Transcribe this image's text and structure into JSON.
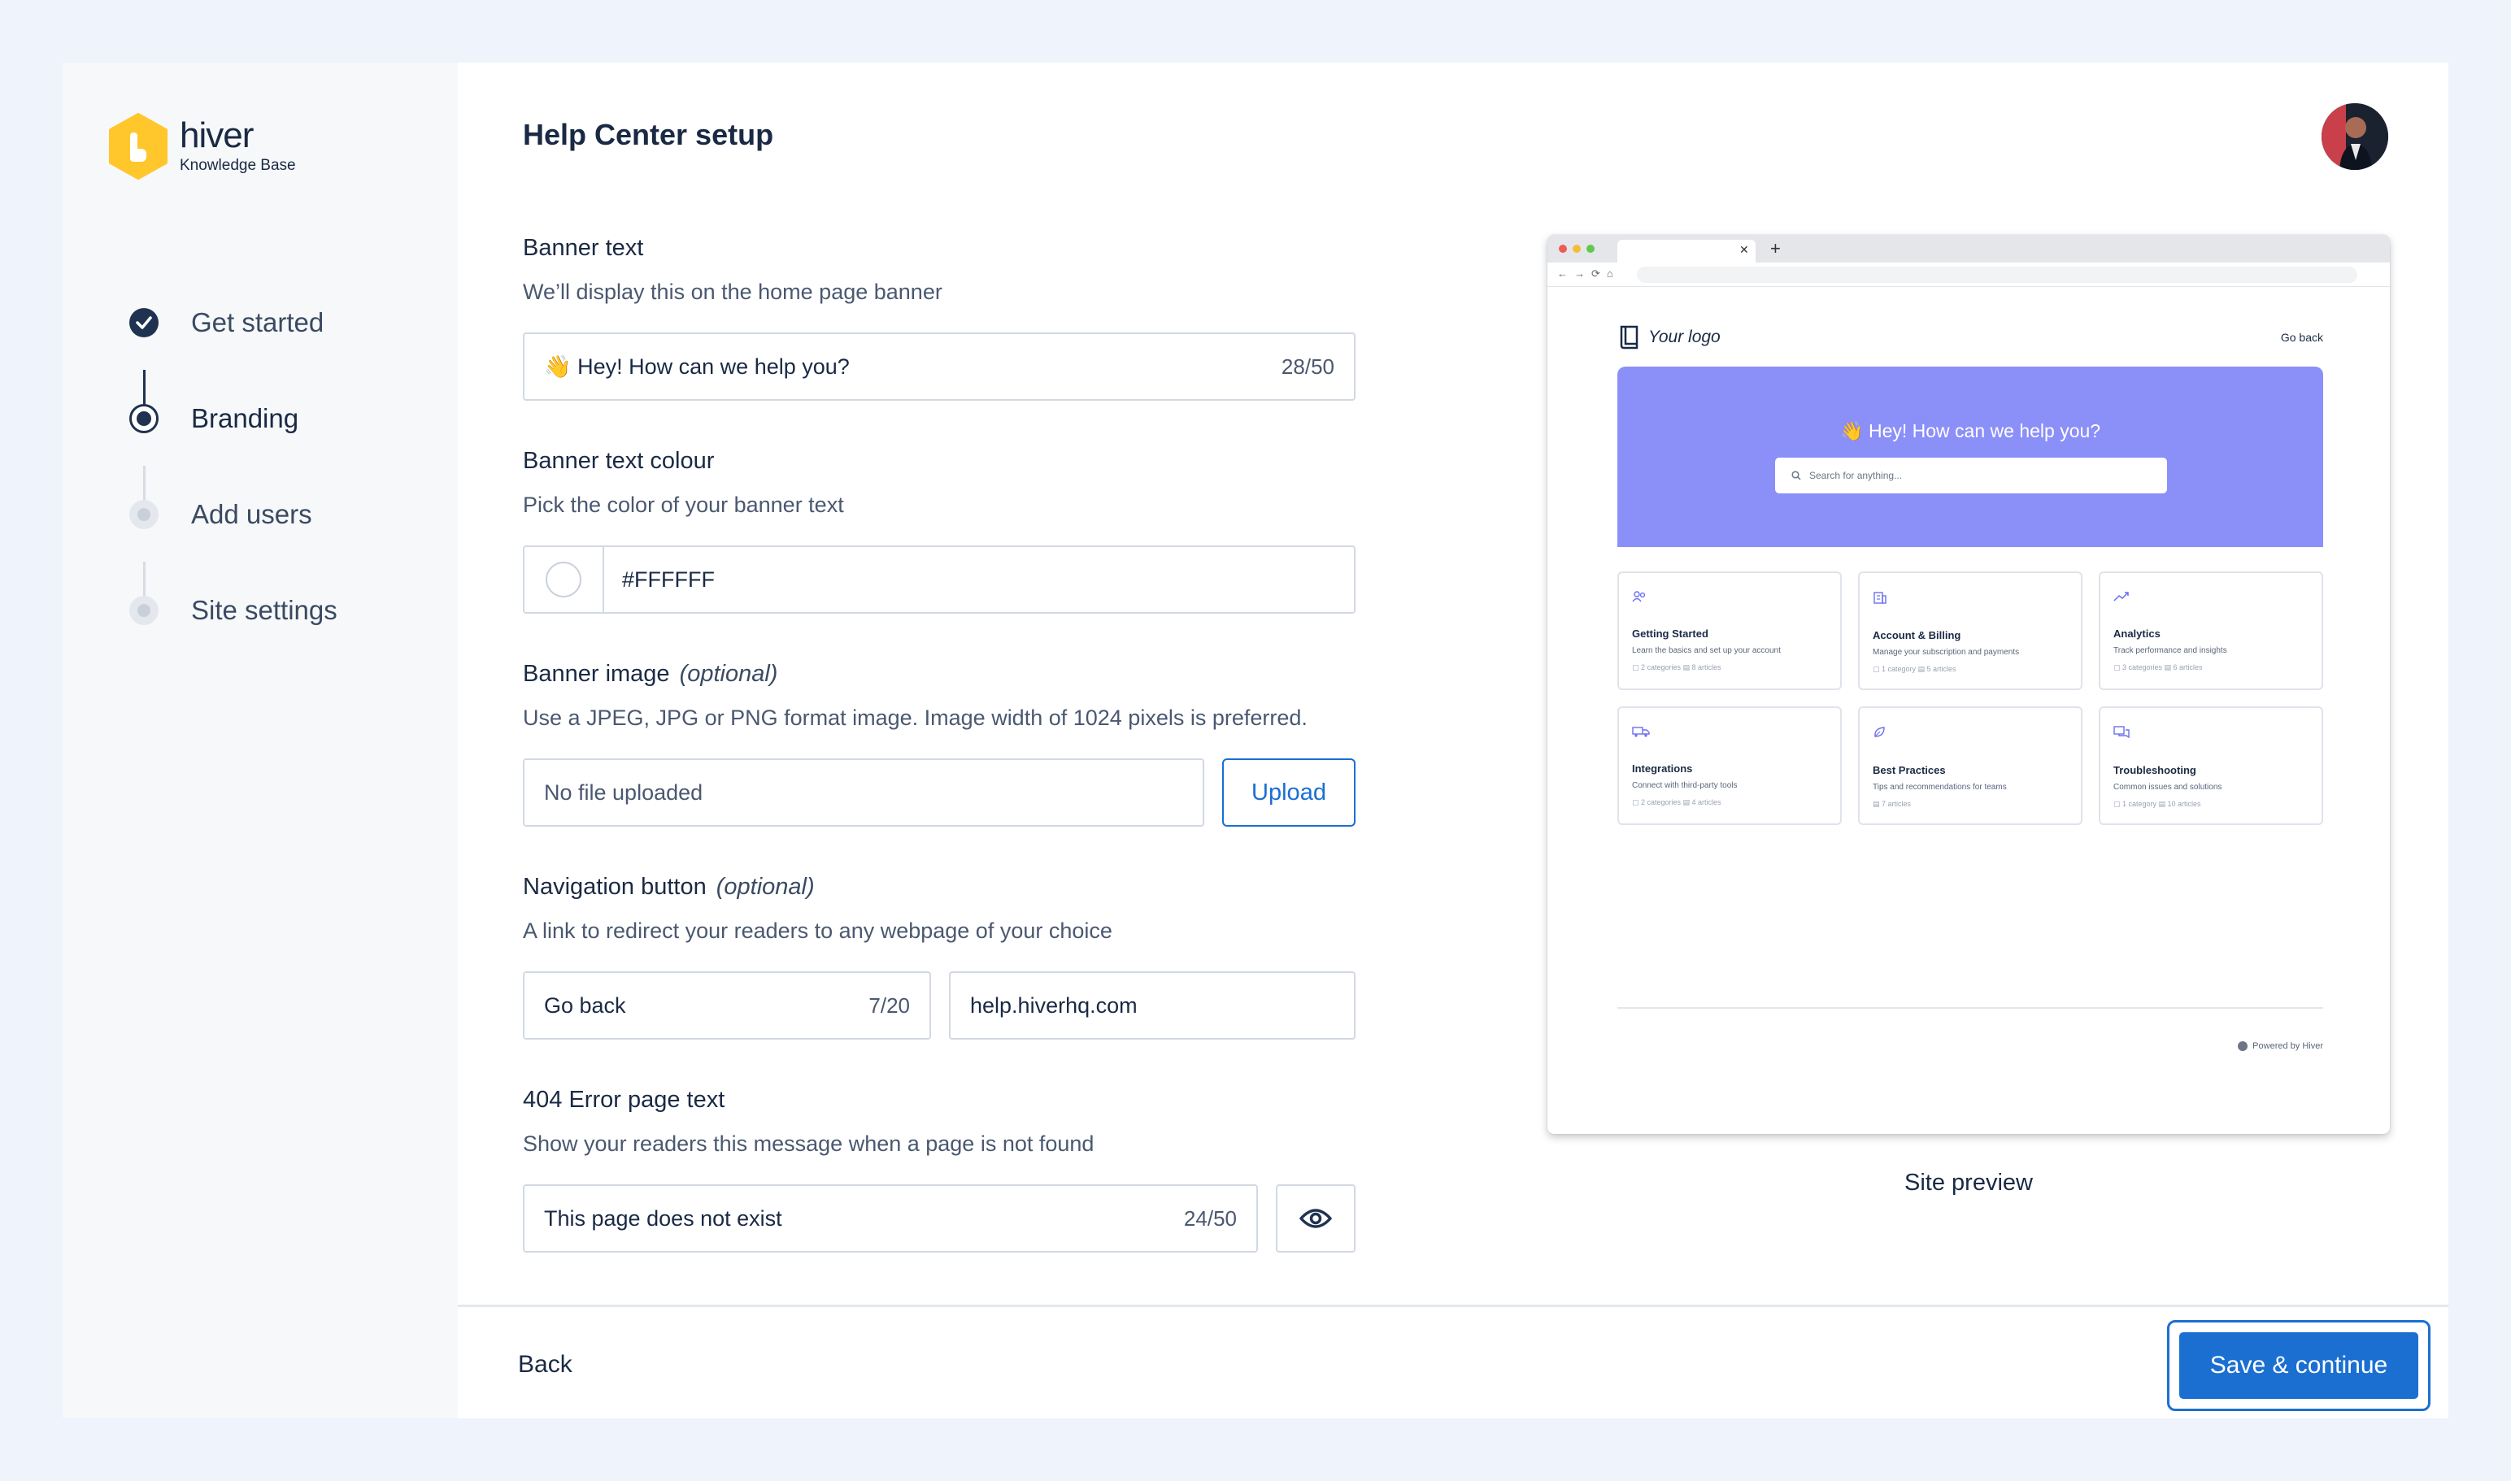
{
  "brand": {
    "name": "hiver",
    "subtitle": "Knowledge Base",
    "color": "#FFC72C"
  },
  "steps": [
    {
      "label": "Get started",
      "status": "done"
    },
    {
      "label": "Branding",
      "status": "current"
    },
    {
      "label": "Add users",
      "status": "pending"
    },
    {
      "label": "Site settings",
      "status": "pending"
    }
  ],
  "page": {
    "title": "Help Center setup"
  },
  "banner_text": {
    "title": "Banner text",
    "help": "We’ll display this on the home page banner",
    "value": "👋 Hey! How can we help you?",
    "counter": "28/50"
  },
  "banner_colour": {
    "title": "Banner text colour",
    "help": "Pick the color of your banner text",
    "value": "#FFFFFF"
  },
  "banner_image": {
    "title": "Banner image",
    "optional": "(optional)",
    "help": "Use a JPEG, JPG or PNG format image. Image width of 1024 pixels is preferred.",
    "value": "No file uploaded",
    "upload_label": "Upload"
  },
  "nav_button": {
    "title": "Navigation button",
    "optional": "(optional)",
    "help": "A link to redirect your readers to any webpage of your choice",
    "label_value": "Go back",
    "label_counter": "7/20",
    "url_value": "help.hiverhq.com"
  },
  "error_page": {
    "title": "404 Error page text",
    "help": "Show your readers this message when a page is not found",
    "value": "This page does not exist",
    "counter": "24/50"
  },
  "preview": {
    "site_logo": "Your logo",
    "go_back": "Go back",
    "banner_text": "👋 Hey! How can we help you?",
    "banner_color": "#8B8FF8",
    "search_placeholder": "Search for anything...",
    "cards": [
      {
        "icon": "users-icon",
        "title": "Getting Started",
        "desc": "Learn the basics and set up your account",
        "meta": "▢ 2 categories   ▤ 8 articles"
      },
      {
        "icon": "building-icon",
        "title": "Account & Billing",
        "desc": "Manage your subscription and payments",
        "meta": "▢ 1 category   ▤ 5 articles"
      },
      {
        "icon": "trend-icon",
        "title": "Analytics",
        "desc": "Track performance and insights",
        "meta": "▢ 3 categories   ▤ 6 articles"
      },
      {
        "icon": "truck-icon",
        "title": "Integrations",
        "desc": "Connect with third-party tools",
        "meta": "▢ 2 categories   ▤ 4 articles"
      },
      {
        "icon": "leaf-icon",
        "title": "Best Practices",
        "desc": "Tips and recommendations for teams",
        "meta": "▤ 7 articles"
      },
      {
        "icon": "chat-icon",
        "title": "Troubleshooting",
        "desc": "Common issues and solutions",
        "meta": "▢ 1 category   ▤ 10 articles"
      }
    ],
    "powered_by": "Powered by Hiver",
    "caption": "Site preview"
  },
  "footer": {
    "back_label": "Back",
    "save_label": "Save & continue"
  },
  "colors": {
    "primary": "#1B6FD1",
    "navy": "#1F3350"
  }
}
